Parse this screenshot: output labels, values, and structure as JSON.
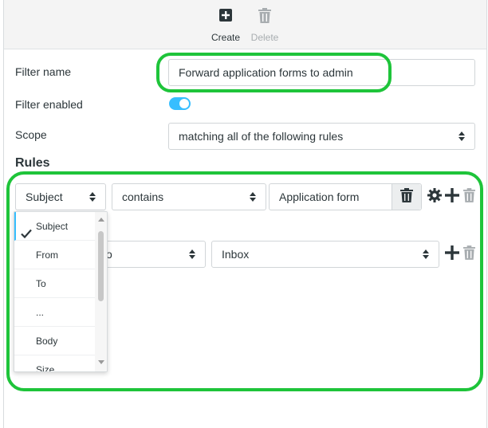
{
  "toolbar": {
    "create_label": "Create",
    "delete_label": "Delete"
  },
  "form": {
    "filter_name_label": "Filter name",
    "filter_name_value": "Forward application forms to admin",
    "filter_enabled_label": "Filter enabled",
    "filter_enabled": true,
    "scope_label": "Scope",
    "scope_value": "matching all of the following rules"
  },
  "rules": {
    "heading": "Rules",
    "rule1": {
      "field": "Subject",
      "operator": "contains",
      "value": "Application form"
    },
    "action1": {
      "partial": "o",
      "target": "Inbox"
    }
  },
  "dropdown": {
    "items": [
      {
        "label": "Subject",
        "selected": true
      },
      {
        "label": "From"
      },
      {
        "label": "To"
      },
      {
        "label": "..."
      },
      {
        "label": "Body"
      },
      {
        "label": "Size"
      }
    ]
  },
  "colors": {
    "accent": "#37beff",
    "highlight": "#1ec43a",
    "text": "#2c363a"
  }
}
